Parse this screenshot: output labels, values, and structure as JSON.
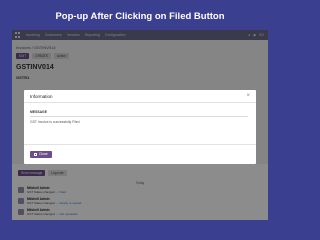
{
  "headline": "Pop-up After Clicking on Filed Button",
  "app": {
    "menu": [
      "Invoicing",
      "Customers",
      "Vendors",
      "Reporting",
      "Configuration"
    ],
    "right": [
      "●",
      "◆",
      "SO"
    ]
  },
  "record": {
    "breadcrumb": "Invoices / GSTINV014",
    "toolbar": [
      "EDIT",
      "CREATE",
      "Action"
    ],
    "title": "GSTINV014",
    "subtitle": "GSTR1"
  },
  "modal": {
    "title": "Information",
    "field_label": "MESSAGE",
    "field_value": "GST Invoice is successfully Filed",
    "close_label": "Close"
  },
  "chatter": {
    "tabs": [
      "Send message",
      "Log note"
    ],
    "today": "Today",
    "entries": [
      {
        "title": "Mitchell Admin",
        "text": "GST Status changed",
        "link": "→ Filed"
      },
      {
        "title": "Mitchell Admin",
        "text": "GST Status changed",
        "link": "→ Ready to upload"
      },
      {
        "title": "Mitchell Admin",
        "text": "GST Status changed",
        "link": "→ Not uploaded"
      }
    ]
  },
  "colors": {
    "brand": "#6b4d8a",
    "background": "#3b3f8f"
  }
}
